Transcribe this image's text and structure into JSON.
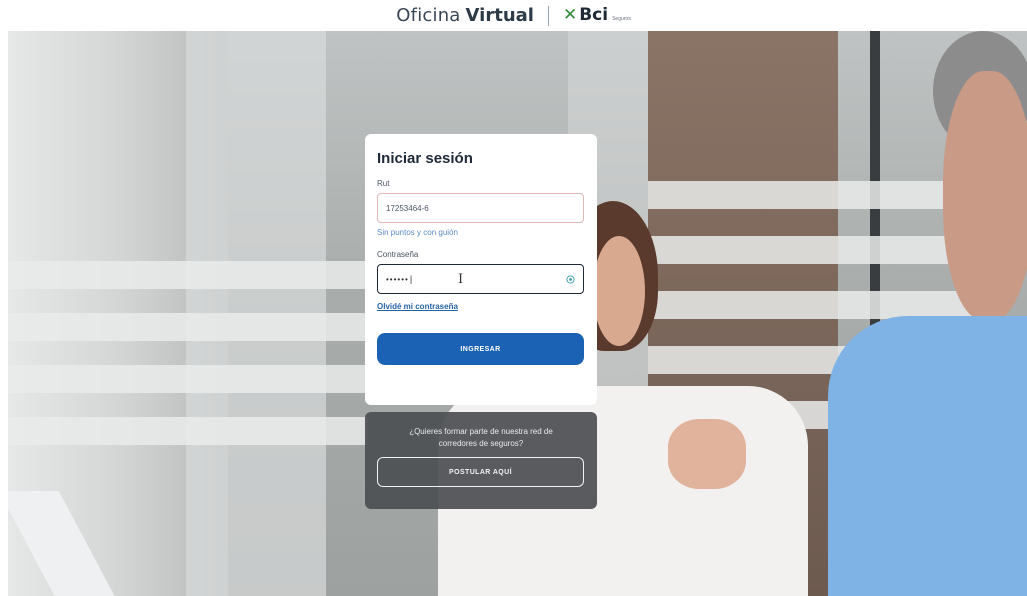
{
  "header": {
    "brand_light": "Oficina",
    "brand_bold": "Virtual",
    "partner_logo_text": "Bci",
    "partner_logo_sub": "Seguros"
  },
  "login": {
    "title": "Iniciar sesión",
    "rut_label": "Rut",
    "rut_value": "17253464-6",
    "rut_hint": "Sin puntos y con guión",
    "password_label": "Contraseña",
    "password_mask": "••••••",
    "forgot_link": "Olvidé mi contraseña",
    "submit_label": "INGRESAR"
  },
  "broker": {
    "question": "¿Quieres formar parte de nuestra red de corredores de seguros?",
    "apply_label": "POSTULAR AQUÍ"
  },
  "colors": {
    "primary_button": "#1c62b4",
    "link": "#2563a6",
    "hint": "#5b8cc7",
    "logo_green": "#2f8a3a"
  },
  "icons": {
    "password_toggle": "eye-icon"
  }
}
